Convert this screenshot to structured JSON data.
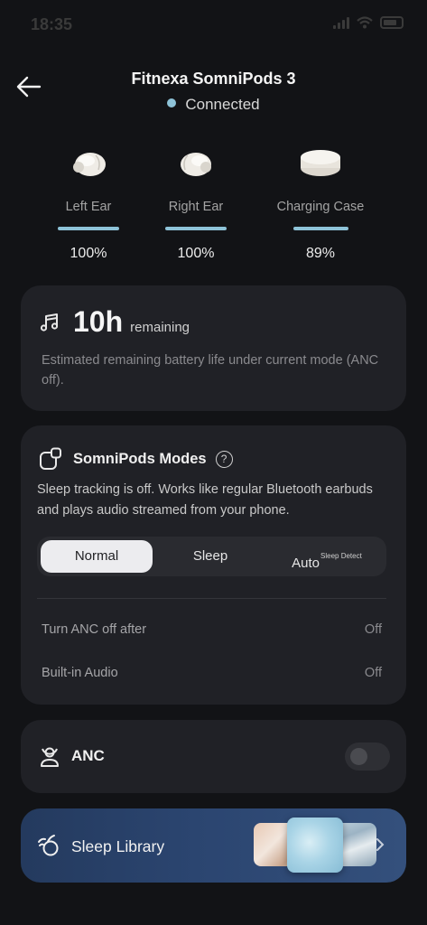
{
  "status": {
    "time": "18:35"
  },
  "header": {
    "title": "Fitnexa SomniPods 3",
    "connection": "Connected"
  },
  "devices": [
    {
      "label": "Left Ear",
      "battery": "100%",
      "level": 1.0
    },
    {
      "label": "Right Ear",
      "battery": "100%",
      "level": 1.0
    },
    {
      "label": "Charging Case",
      "battery": "89%",
      "level": 0.89
    }
  ],
  "remaining": {
    "hours": "10h",
    "suffix": "remaining",
    "description": "Estimated remaining battery life under current mode (ANC off)."
  },
  "modes": {
    "title": "SomniPods Modes",
    "help": "?",
    "description": "Sleep tracking is off. Works like regular Bluetooth earbuds and plays audio streamed from your phone.",
    "options": [
      {
        "label": "Normal",
        "active": true
      },
      {
        "label": "Sleep",
        "active": false
      },
      {
        "label": "Auto",
        "superscript": "Sleep Detect",
        "active": false
      }
    ],
    "settings": [
      {
        "label": "Turn ANC off after",
        "value": "Off"
      },
      {
        "label": "Built-in Audio",
        "value": "Off"
      }
    ]
  },
  "anc": {
    "label": "ANC",
    "enabled": false
  },
  "library": {
    "label": "Sleep Library"
  },
  "colors": {
    "accent": "#8ec3d8",
    "background": "#121316",
    "card": "#202126",
    "library_gradient_start": "#243a5e"
  }
}
